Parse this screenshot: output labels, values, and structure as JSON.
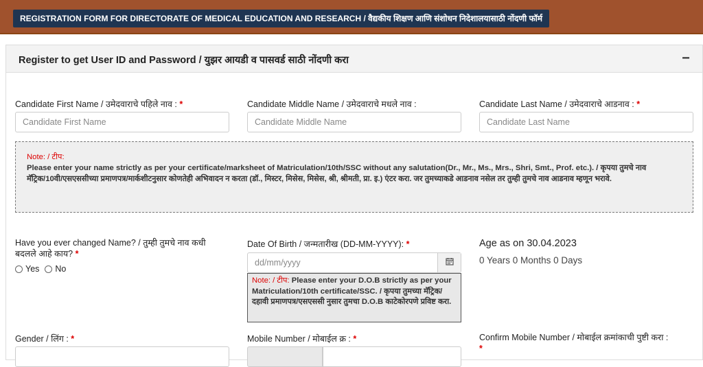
{
  "header": {
    "form_title": "REGISTRATION FORM FOR DIRECTORATE OF MEDICAL EDUCATION AND RESEARCH / वैद्यकीय शिक्षण आणि संशोधन निदेशालयासाठी नोंदणी फॉर्म"
  },
  "panel": {
    "title": "Register to get User ID and Password / युझर आयडी व पासवर्ड साठी नोंदणी करा",
    "collapse_symbol": "−"
  },
  "fields": {
    "first_name": {
      "label": "Candidate First Name / उमेदवाराचे पहिले नाव : ",
      "placeholder": "Candidate First Name",
      "required": "*"
    },
    "middle_name": {
      "label": "Candidate Middle Name / उमेदवाराचे मधले नाव :",
      "placeholder": "Candidate Middle Name"
    },
    "last_name": {
      "label": "Candidate Last Name / उमेदवाराचे आडनाव : ",
      "placeholder": "Candidate Last Name",
      "required": "*"
    },
    "name_changed": {
      "label_line1": "Have you ever changed Name? / तुम्ही तुमचे नाव कधी",
      "label_line2": "बदलले आहे काय? ",
      "required": "*",
      "option_yes": "Yes",
      "option_no": "No"
    },
    "dob": {
      "label": "Date Of Birth / जन्मतारीख (DD-MM-YYYY): ",
      "placeholder": "dd/mm/yyyy",
      "required": "*"
    },
    "gender": {
      "label": "Gender / लिंग : ",
      "required": "*"
    },
    "mobile": {
      "label": "Mobile Number / मोबाईल क्र : ",
      "required": "*"
    },
    "confirm_mobile": {
      "label": "Confirm Mobile Number / मोबाईल क्रमांकाची पुष्टी करा :",
      "required": "*"
    }
  },
  "name_note": {
    "label": "Note: / टीप:",
    "text": "Please enter your name strictly as per your certificate/marksheet of Matriculation/10th/SSC without any salutation(Dr., Mr., Ms., Mrs., Shri, Smt., Prof. etc.). / कृपया तुमचे नाव मॅट्रिक/10वी/एसएससीच्या प्रमाणपत्र/मार्कशीटनुसार कोणतेही अभिवादन न करता (डॉ., मिस्टर, मिसेस, मिसेस, श्री, श्रीमती, प्रा. इ.) एंटर करा. जर तुमच्याकडे आडनाव नसेल तर तुम्ही तुमचे नाव आडनाव म्हणून भरावे."
  },
  "dob_note": {
    "label": "Note: / टीप:",
    "text": " Please enter your D.O.B strictly as per your Matriculation/10th certificate/SSC. / कृपया तुमच्या मॅट्रिक/दहावी प्रमाणपत्र/एसएससी नुसार तुमचा D.O.B काटेकोरपणे प्रविष्ट करा."
  },
  "age": {
    "title": "Age as on 30.04.2023",
    "value": "0 Years 0 Months 0 Days"
  },
  "icons": {
    "calendar": "calendar-icon"
  }
}
